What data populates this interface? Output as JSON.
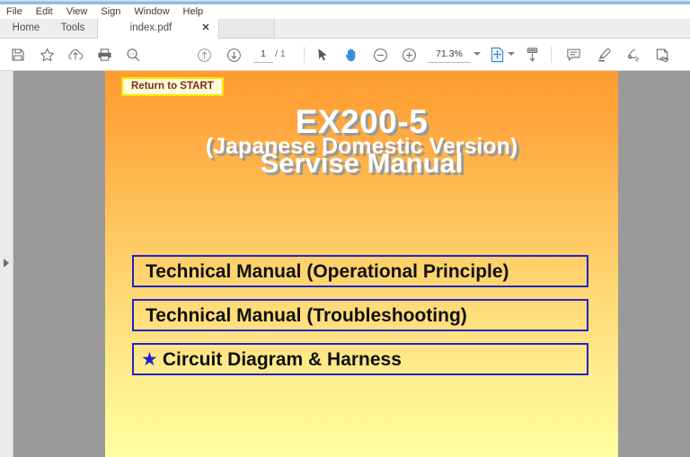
{
  "window": {
    "menu": [
      "File",
      "Edit",
      "View",
      "Sign",
      "Window",
      "Help"
    ]
  },
  "tabs": {
    "home_label": "Home",
    "tools_label": "Tools",
    "document_label": "index.pdf",
    "close_glyph": "✕"
  },
  "toolbar": {
    "icons": [
      {
        "name": "save-icon",
        "title": "Save"
      },
      {
        "name": "star-icon",
        "title": "Add to favorites"
      },
      {
        "name": "cloud-upload-icon",
        "title": "Send file"
      },
      {
        "name": "print-icon",
        "title": "Print"
      },
      {
        "name": "search-icon",
        "title": "Find"
      },
      {
        "name": "page-up-icon",
        "title": "Previous page"
      },
      {
        "name": "page-down-icon",
        "title": "Next page"
      },
      {
        "name": "select-cursor-icon",
        "title": "Select tool"
      },
      {
        "name": "hand-tool-icon",
        "title": "Hand tool"
      },
      {
        "name": "zoom-out-icon",
        "title": "Zoom out"
      },
      {
        "name": "zoom-in-icon",
        "title": "Zoom in"
      },
      {
        "name": "fit-page-icon",
        "title": "Fit page"
      },
      {
        "name": "scroll-mode-icon",
        "title": "Scroll mode"
      },
      {
        "name": "comment-icon",
        "title": "Add comment"
      },
      {
        "name": "highlight-icon",
        "title": "Highlight text"
      },
      {
        "name": "sign-icon",
        "title": "Sign"
      },
      {
        "name": "stamp-icon",
        "title": "Stamp"
      }
    ],
    "page_current": "1",
    "page_total": "/ 1",
    "zoom_level": "71.3%"
  },
  "document": {
    "return_button": "Return to START",
    "title_line1": "EX200-5",
    "title_line2": "(Japanese Domestic Version)",
    "title_line3": "Servise Manual",
    "menu_items": [
      {
        "star": "",
        "label": "Technical Manual (Operational Principle)"
      },
      {
        "star": "",
        "label": "Technical Manual (Troubleshooting)"
      },
      {
        "star": "★",
        "label": "Circuit Diagram & Harness"
      }
    ]
  },
  "colors": {
    "page_top": "#FF9D2E",
    "page_bottom": "#FFFEA3",
    "box_border": "#2222CC",
    "return_bg": "#FFFDD6",
    "return_border": "#F7E600",
    "return_text": "#7A2B25",
    "title_text": "#FFFFFF",
    "title_shadow": "#999999",
    "viewport_bg": "#9A9A9A"
  }
}
